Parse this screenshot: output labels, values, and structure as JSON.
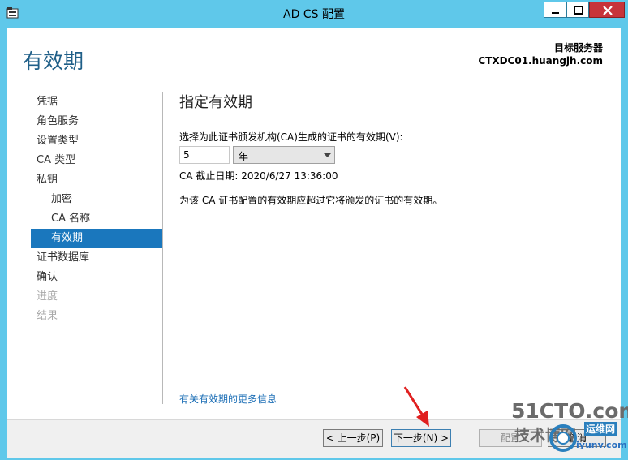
{
  "window": {
    "title": "AD CS 配置"
  },
  "header": {
    "page_title": "有效期",
    "target_label": "目标服务器",
    "target_value": "CTXDC01.huangjh.com"
  },
  "nav": {
    "items": [
      {
        "label": "凭据",
        "state": "normal",
        "level": 0
      },
      {
        "label": "角色服务",
        "state": "normal",
        "level": 0
      },
      {
        "label": "设置类型",
        "state": "normal",
        "level": 0
      },
      {
        "label": "CA 类型",
        "state": "normal",
        "level": 0
      },
      {
        "label": "私钥",
        "state": "normal",
        "level": 0
      },
      {
        "label": "加密",
        "state": "normal",
        "level": 1
      },
      {
        "label": "CA 名称",
        "state": "normal",
        "level": 1
      },
      {
        "label": "有效期",
        "state": "active",
        "level": 1
      },
      {
        "label": "证书数据库",
        "state": "normal",
        "level": 0
      },
      {
        "label": "确认",
        "state": "normal",
        "level": 0
      },
      {
        "label": "进度",
        "state": "disabled",
        "level": 0
      },
      {
        "label": "结果",
        "state": "disabled",
        "level": 0
      }
    ]
  },
  "content": {
    "section_title": "指定有效期",
    "prompt_label": "选择为此证书颁发机构(CA)生成的证书的有效期(V):",
    "period_value": "5",
    "unit_selected": "年",
    "expiry_text": "CA 截止日期: 2020/6/27 13:36:00",
    "note_text": "为该 CA 证书配置的有效期应超过它将颁发的证书的有效期。",
    "more_info_link": "有关有效期的更多信息"
  },
  "footer": {
    "prev_label": "< 上一步(P)",
    "next_label": "下一步(N) >",
    "configure_label": "配置",
    "cancel_label": "取消"
  },
  "watermark": {
    "line1": "51CTO.com",
    "line2": "技术博客",
    "line3": "运维网",
    "line4": "iyunv.com"
  },
  "colors": {
    "frame": "#5fc8ea",
    "accent": "#1a77bd",
    "heading": "#1f5f88",
    "link": "#1a6db5",
    "close_button": "#c7343a",
    "annotation_arrow": "#e02020"
  }
}
